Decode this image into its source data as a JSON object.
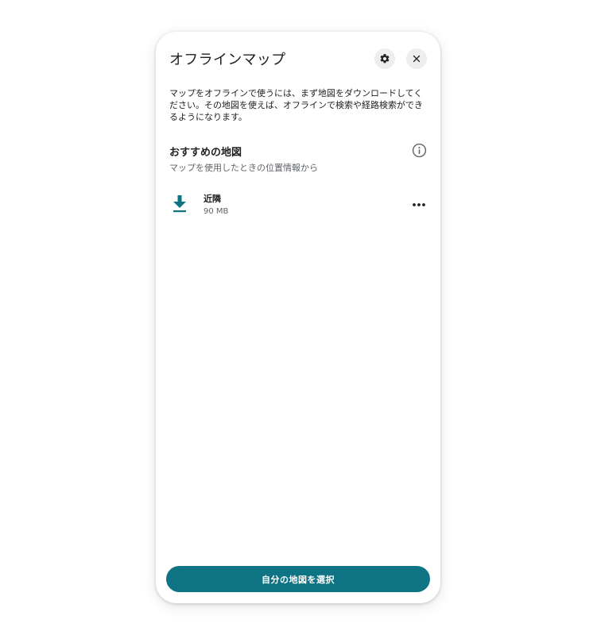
{
  "panel": {
    "title": "オフラインマップ",
    "description": "マップをオフラインで使うには、まず地図をダウンロードしてください。その地図を使えば、オフラインで検索や経路検索ができるようになります。"
  },
  "header": {
    "settings_icon": "gear-icon",
    "close_icon": "close-icon"
  },
  "recommended": {
    "title": "おすすめの地図",
    "subtitle": "マップを使用したときの位置情報から",
    "info_icon": "info-icon",
    "items": [
      {
        "name": "近隣",
        "size": "90 MB",
        "icon": "download-icon",
        "menu_icon": "more-horizontal-icon"
      }
    ]
  },
  "footer": {
    "select_button_label": "自分の地図を選択"
  },
  "colors": {
    "accent": "#0e7483",
    "text_primary": "#202124",
    "text_secondary": "#5f6368",
    "icon_button_bg": "#eeeeee"
  }
}
